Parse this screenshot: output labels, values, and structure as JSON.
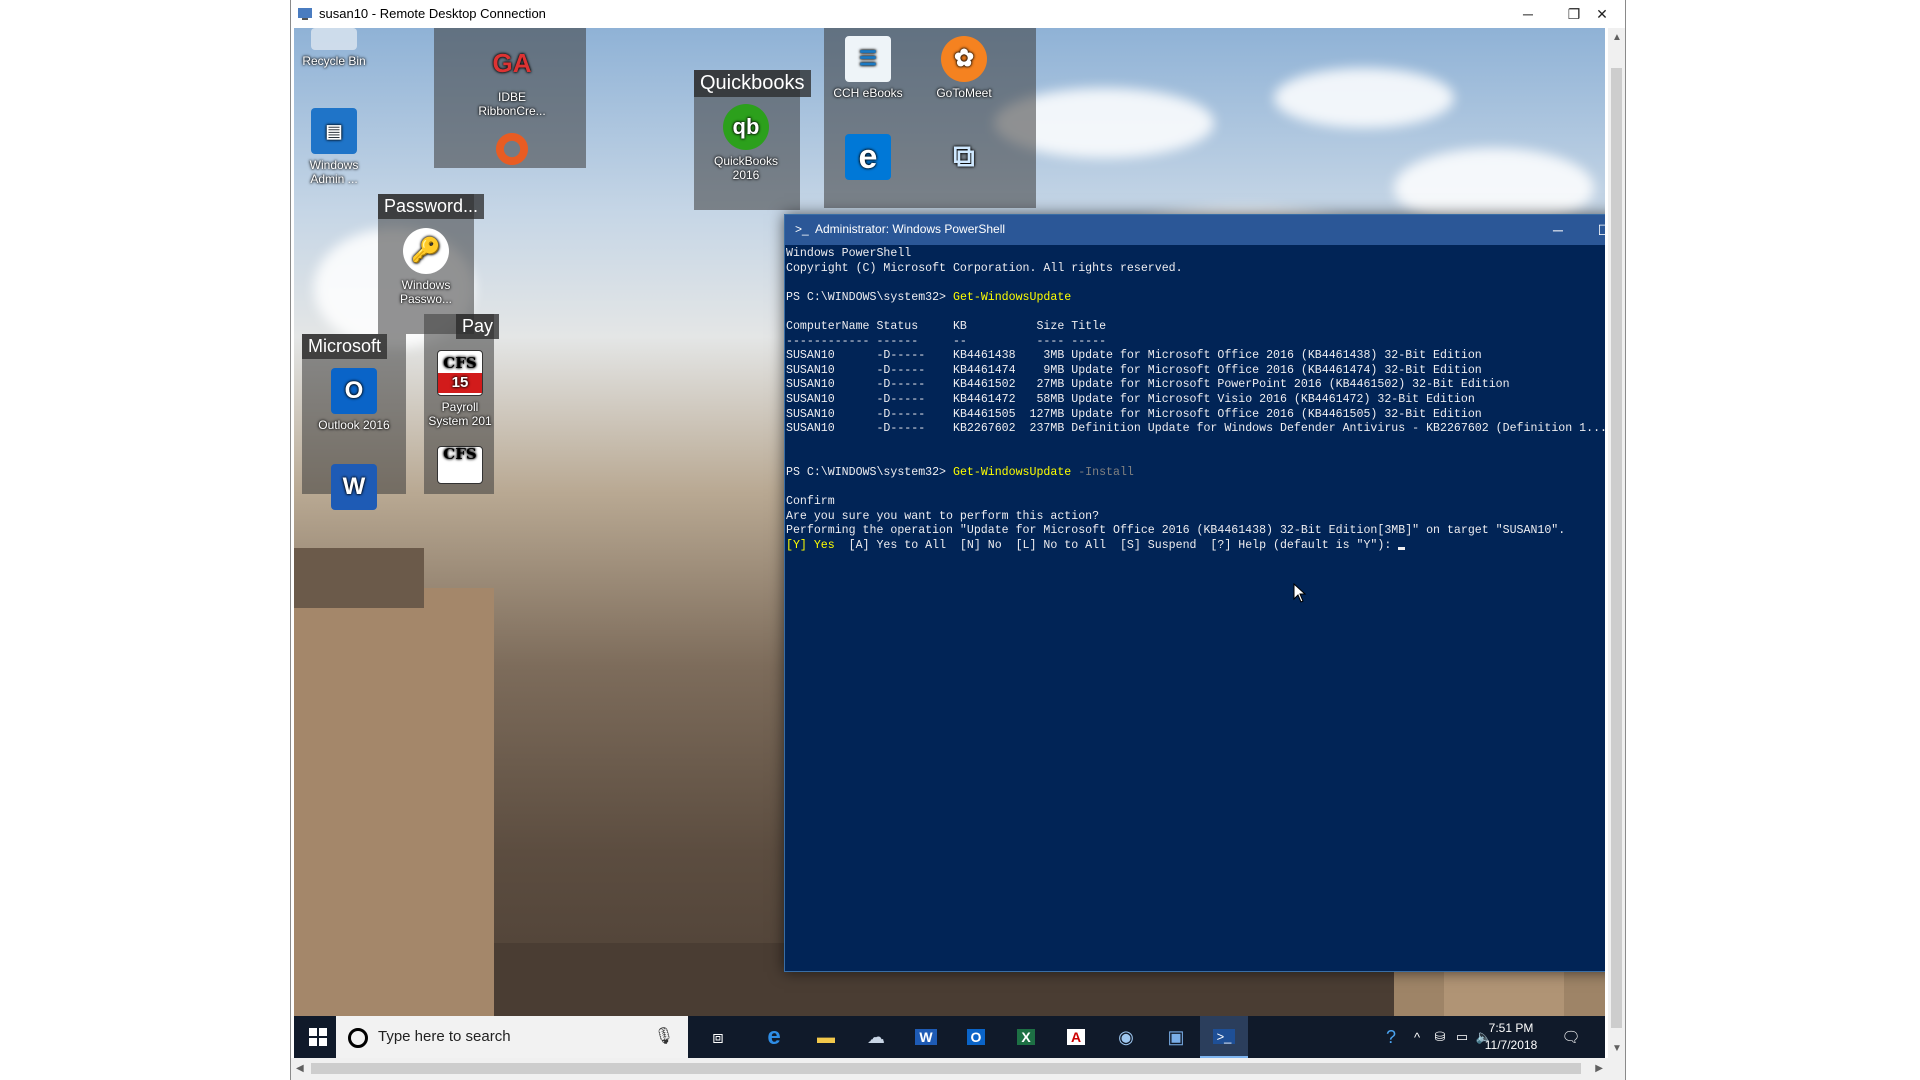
{
  "rdp_window": {
    "title": "susan10 - Remote Desktop Connection",
    "minimize": "─",
    "restore": "❐",
    "close": "✕"
  },
  "desktop": {
    "icons": [
      {
        "label": "Recycle Bin",
        "icon": "recycle-bin-icon"
      },
      {
        "label": "Windows Admin ...",
        "icon": "windows-admin-icon"
      },
      {
        "label": "IDBE RibbonCre...",
        "icon": "idbe-icon"
      },
      {
        "label": "QuickBooks 2016",
        "icon": "quickbooks-icon"
      },
      {
        "label": "CCH eBooks",
        "icon": "cch-ebooks-icon"
      },
      {
        "label": "GoToMeet",
        "icon": "gotomeeting-icon"
      },
      {
        "label": "Windows Passwo...",
        "icon": "windows-password-icon"
      },
      {
        "label": "Outlook 2016",
        "icon": "outlook-icon"
      },
      {
        "label": "Payroll System 201",
        "icon": "cfs-payroll-icon"
      }
    ],
    "groups": {
      "quickbooks": "Quickbooks",
      "password": "Password...",
      "microsoft": "Microsoft",
      "payroll": "Pay"
    },
    "cfs_badge_top": "CFS",
    "cfs_badge_num": "15",
    "cfs_badge2_top": "CFS",
    "word_glyph": "W",
    "outlook_glyph": "O",
    "qb_glyph": "qb",
    "idbe_glyph": "GA",
    "edge_glyph": "e"
  },
  "powershell": {
    "title": "Administrator: Windows PowerShell",
    "lines": {
      "l1": "Windows PowerShell",
      "l2": "Copyright (C) Microsoft Corporation. All rights reserved.",
      "prompt1": "PS C:\\WINDOWS\\system32> ",
      "cmd1": "Get-WindowsUpdate",
      "header": "ComputerName Status     KB          Size Title",
      "divider": "------------ ------     --          ---- -----",
      "prompt2": "PS C:\\WINDOWS\\system32> ",
      "cmd2": "Get-WindowsUpdate",
      "param2": " -Install",
      "confirm": "Confirm",
      "question": "Are you sure you want to perform this action?",
      "operation": "Performing the operation \"Update for Microsoft Office 2016 (KB4461438) 32-Bit Edition[3MB]\" on target \"SUSAN10\".",
      "choice_yes": "[Y] Yes",
      "choice_rest": "  [A] Yes to All  [N] No  [L] No to All  [S] Suspend  [?] Help (default is \"Y\"): "
    },
    "updates": [
      {
        "computer": "SUSAN10",
        "status": "-D-----",
        "kb": "KB4461438",
        "size": "3MB",
        "title": "Update for Microsoft Office 2016 (KB4461438) 32-Bit Edition"
      },
      {
        "computer": "SUSAN10",
        "status": "-D-----",
        "kb": "KB4461474",
        "size": "9MB",
        "title": "Update for Microsoft Office 2016 (KB4461474) 32-Bit Edition"
      },
      {
        "computer": "SUSAN10",
        "status": "-D-----",
        "kb": "KB4461502",
        "size": "27MB",
        "title": "Update for Microsoft PowerPoint 2016 (KB4461502) 32-Bit Edition"
      },
      {
        "computer": "SUSAN10",
        "status": "-D-----",
        "kb": "KB4461472",
        "size": "58MB",
        "title": "Update for Microsoft Visio 2016 (KB4461472) 32-Bit Edition"
      },
      {
        "computer": "SUSAN10",
        "status": "-D-----",
        "kb": "KB4461505",
        "size": "127MB",
        "title": "Update for Microsoft Office 2016 (KB4461505) 32-Bit Edition"
      },
      {
        "computer": "SUSAN10",
        "status": "-D-----",
        "kb": "KB2267602",
        "size": "237MB",
        "title": "Definition Update for Windows Defender Antivirus - KB2267602 (Definition 1...."
      }
    ]
  },
  "taskbar": {
    "search_placeholder": "Type here to search",
    "time": "7:51 PM",
    "date": "11/7/2018"
  }
}
